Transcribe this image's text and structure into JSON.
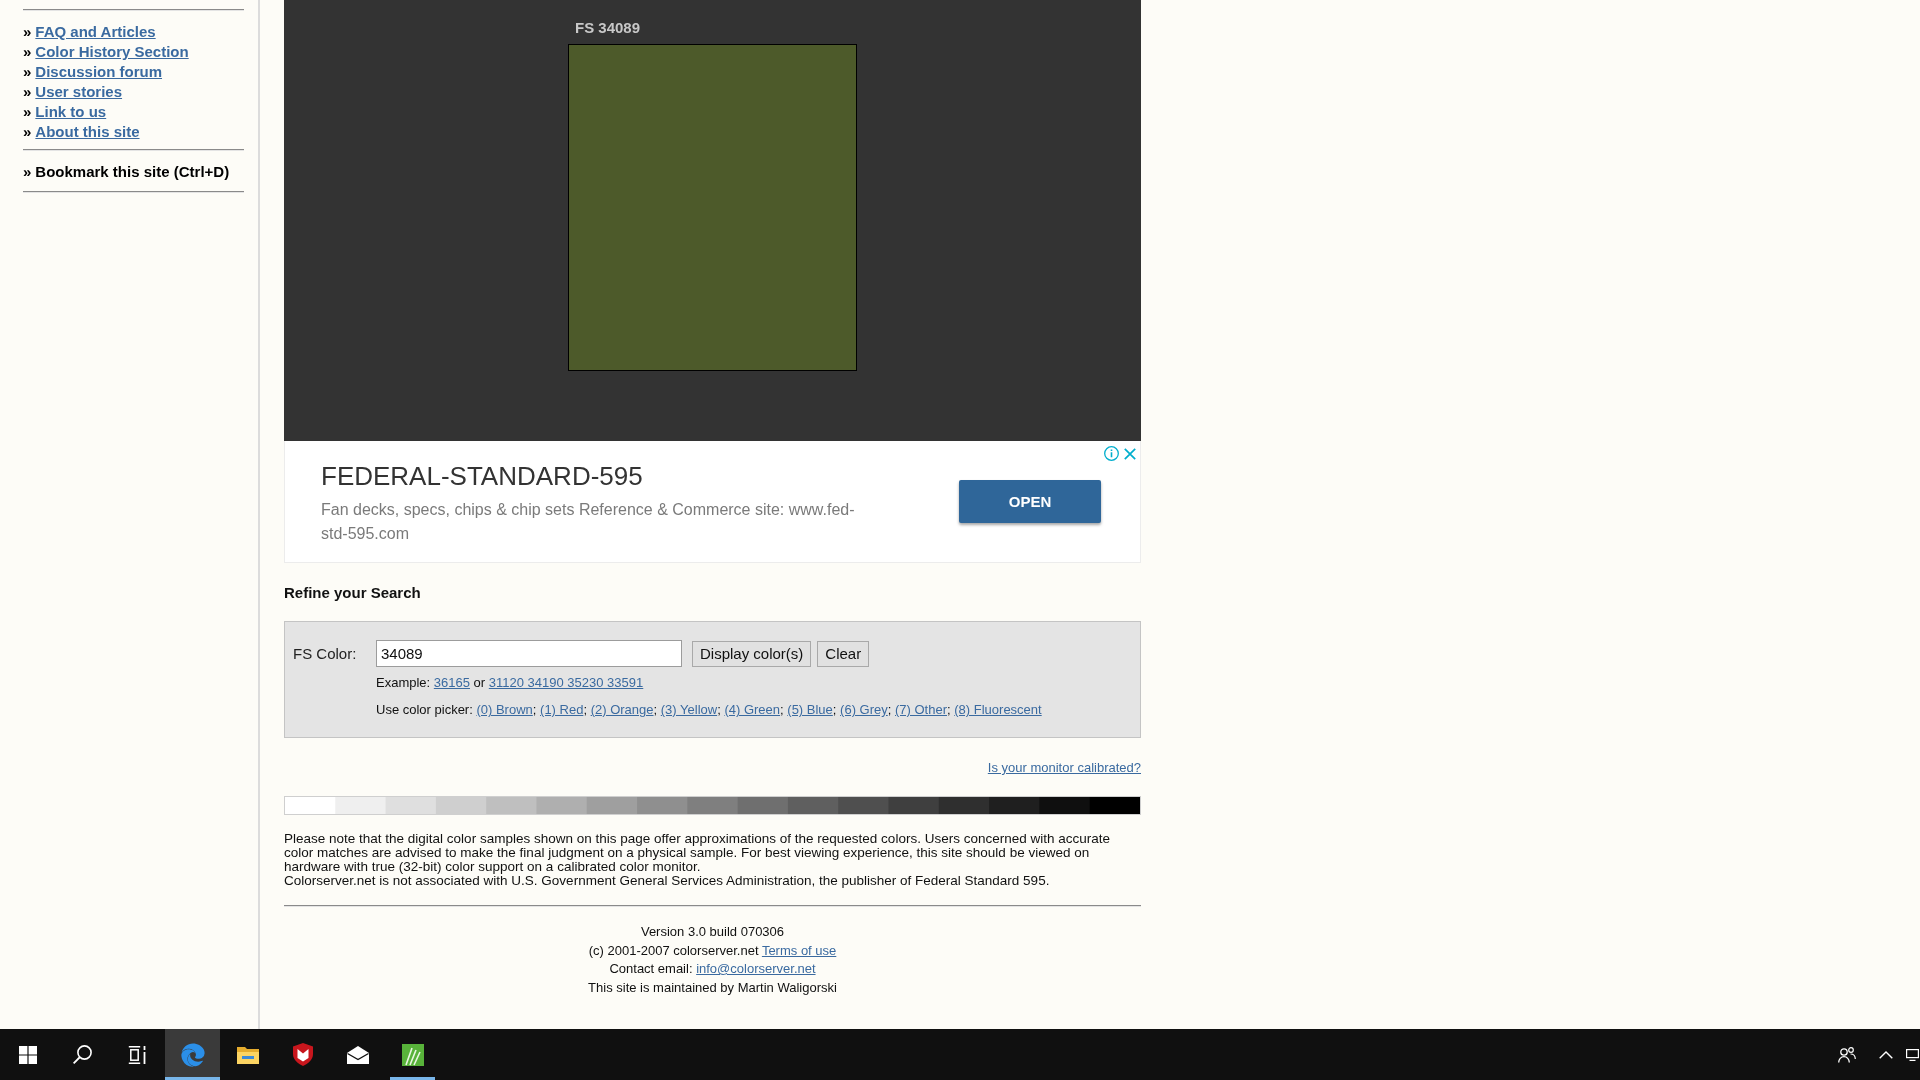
{
  "sidebar": {
    "links": [
      {
        "bullet": "»",
        "label": "FAQ and Articles"
      },
      {
        "bullet": "»",
        "label": "Color History Section"
      },
      {
        "bullet": "»",
        "label": "Discussion forum"
      },
      {
        "bullet": "»",
        "label": "User stories"
      },
      {
        "bullet": "»",
        "label": "Link to us"
      },
      {
        "bullet": "»",
        "label": "About this site"
      }
    ],
    "bookmark": {
      "bullet": "»",
      "label": "Bookmark this site (Ctrl+D)"
    }
  },
  "swatches": [
    {
      "label": "FS 34089",
      "color": "#4d5a2a"
    }
  ],
  "ad": {
    "title": "FEDERAL-STANDARD-595",
    "description": "Fan decks, specs, chips & chip sets Reference & Commerce site: www.fed-std-595.com",
    "button": "OPEN"
  },
  "refine": {
    "heading": "Refine your Search",
    "field_label": "FS Color:",
    "value": "34089",
    "buttons": [
      "Display color(s)",
      "Clear"
    ],
    "example": {
      "label": "Example:",
      "single": "36165",
      "conjunction": "or",
      "multiple": "31120 34190 35230 33591"
    },
    "picker": {
      "label": "Use color picker:",
      "options": [
        {
          "label": "(0) Brown",
          "separator": ";"
        },
        {
          "label": "(1) Red",
          "separator": ";"
        },
        {
          "label": "(2) Orange",
          "separator": ";"
        },
        {
          "label": "(3) Yellow",
          "separator": ";"
        },
        {
          "label": "(4) Green",
          "separator": ";"
        },
        {
          "label": "(5) Blue",
          "separator": ";"
        },
        {
          "label": "(6) Grey",
          "separator": ";"
        },
        {
          "label": "(7) Other",
          "separator": ";"
        },
        {
          "label": "(8) Fluorescent"
        }
      ]
    }
  },
  "calibration_link": "Is your monitor calibrated?",
  "disclaimer": [
    "Please note that the digital color samples shown on this page offer approximations of the requested colors. Users concerned with accurate color matches are advised to make the final judgment on a physical sample. For best viewing experience, this site should be viewed on hardware with true (32-bit) color support on a calibrated color monitor.",
    "Colorserver.net is not associated with U.S. Government General Services Administration, the publisher of Federal Standard 595."
  ],
  "footer": {
    "version": "Version 3.0 build 070306",
    "copyright": {
      "text": "(c) 2001-2007 colorserver.net",
      "link": "Terms of use"
    },
    "contact": {
      "text": "Contact email:",
      "link": "info@colorserver.net"
    },
    "maintainer": "This site is maintained by Martin Waligorski"
  },
  "taskbar": {
    "apps": [
      {
        "selected": true,
        "running": true
      },
      {
        "selected": false,
        "running": false
      },
      {
        "selected": false,
        "running": false
      },
      {
        "selected": false,
        "running": false
      },
      {
        "selected": false,
        "running": true
      }
    ]
  }
}
